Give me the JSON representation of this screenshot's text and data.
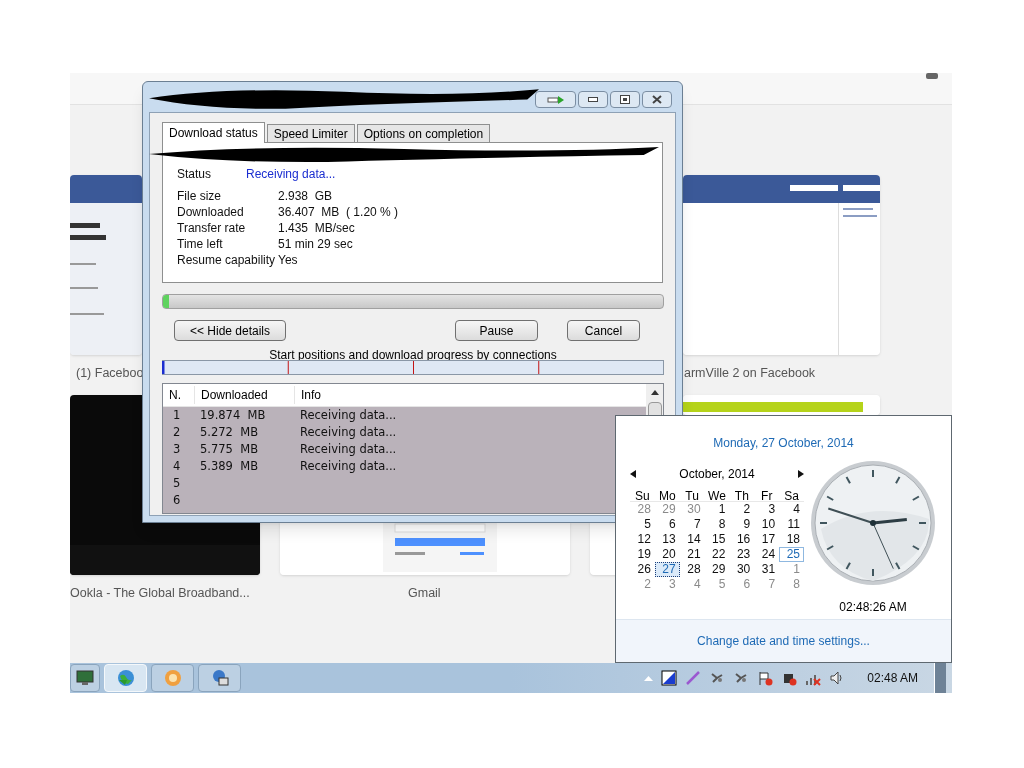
{
  "browser": {
    "tiles": [
      {
        "kind": "facebook",
        "caption": "(1) Faceboo"
      },
      {
        "kind": "farmville",
        "caption": "armVille 2 on Facebook"
      },
      {
        "kind": "ookla",
        "caption": "Ookla - The Global Broadband..."
      },
      {
        "kind": "gmail",
        "caption": "Gmail"
      },
      {
        "kind": "green"
      },
      {
        "kind": "blank"
      }
    ]
  },
  "download_window": {
    "tabs": [
      {
        "label": "Download status",
        "selected": true
      },
      {
        "label": "Speed Limiter",
        "selected": false
      },
      {
        "label": "Options on completion",
        "selected": false
      }
    ],
    "status": {
      "label": "Status",
      "value": "Receiving data..."
    },
    "details": [
      {
        "label": "File size",
        "value": "2.938  GB"
      },
      {
        "label": "Downloaded",
        "value": "36.407  MB  ( 1.20 % )"
      },
      {
        "label": "Transfer rate",
        "value": "1.435  MB/sec"
      },
      {
        "label": "Time left",
        "value": "51 min 29 sec"
      },
      {
        "label": "Resume capability",
        "value": "Yes"
      }
    ],
    "progress": {
      "level": 0.012
    },
    "buttons": {
      "hide_details": "<< Hide details",
      "pause": "Pause",
      "cancel": "Cancel"
    },
    "connections_caption": "Start positions and download progress by connections",
    "table": {
      "columns": [
        "N.",
        "Downloaded",
        "Info"
      ],
      "rows": [
        {
          "n": "1",
          "downloaded": "19.874  MB",
          "info": "Receiving data..."
        },
        {
          "n": "2",
          "downloaded": "5.272  MB",
          "info": "Receiving data..."
        },
        {
          "n": "3",
          "downloaded": "5.775  MB",
          "info": "Receiving data..."
        },
        {
          "n": "4",
          "downloaded": "5.389  MB",
          "info": "Receiving data..."
        },
        {
          "n": "5"
        },
        {
          "n": "6"
        }
      ]
    }
  },
  "calendar": {
    "heading": "Monday, 27 October, 2014",
    "month": "October, 2014",
    "weekdays": [
      "Su",
      "Mo",
      "Tu",
      "We",
      "Th",
      "Fr",
      "Sa"
    ],
    "weeks": [
      [
        {
          "d": "28",
          "muted": true,
          "selected": false,
          "hovered": false
        },
        {
          "d": "29",
          "muted": true,
          "selected": false,
          "hovered": false
        },
        {
          "d": "30",
          "muted": true,
          "selected": false,
          "hovered": false
        },
        {
          "d": "1",
          "muted": false,
          "selected": false,
          "hovered": false
        },
        {
          "d": "2",
          "muted": false,
          "selected": false,
          "hovered": false
        },
        {
          "d": "3",
          "muted": false,
          "selected": false,
          "hovered": false
        },
        {
          "d": "4",
          "muted": false,
          "selected": false,
          "hovered": false
        }
      ],
      [
        {
          "d": "5",
          "muted": false,
          "selected": false,
          "hovered": false
        },
        {
          "d": "6",
          "muted": false,
          "selected": false,
          "hovered": false
        },
        {
          "d": "7",
          "muted": false,
          "selected": false,
          "hovered": false
        },
        {
          "d": "8",
          "muted": false,
          "selected": false,
          "hovered": false
        },
        {
          "d": "9",
          "muted": false,
          "selected": false,
          "hovered": false
        },
        {
          "d": "10",
          "muted": false,
          "selected": false,
          "hovered": false
        },
        {
          "d": "11",
          "muted": false,
          "selected": false,
          "hovered": false
        }
      ],
      [
        {
          "d": "12",
          "muted": false,
          "selected": false,
          "hovered": false
        },
        {
          "d": "13",
          "muted": false,
          "selected": false,
          "hovered": false
        },
        {
          "d": "14",
          "muted": false,
          "selected": false,
          "hovered": false
        },
        {
          "d": "15",
          "muted": false,
          "selected": false,
          "hovered": false
        },
        {
          "d": "16",
          "muted": false,
          "selected": false,
          "hovered": false
        },
        {
          "d": "17",
          "muted": false,
          "selected": false,
          "hovered": false
        },
        {
          "d": "18",
          "muted": false,
          "selected": false,
          "hovered": false
        }
      ],
      [
        {
          "d": "19",
          "muted": false,
          "selected": false,
          "hovered": false
        },
        {
          "d": "20",
          "muted": false,
          "selected": false,
          "hovered": false
        },
        {
          "d": "21",
          "muted": false,
          "selected": false,
          "hovered": false
        },
        {
          "d": "22",
          "muted": false,
          "selected": false,
          "hovered": false
        },
        {
          "d": "23",
          "muted": false,
          "selected": false,
          "hovered": false
        },
        {
          "d": "24",
          "muted": false,
          "selected": false,
          "hovered": false
        },
        {
          "d": "25",
          "muted": false,
          "selected": false,
          "hovered": true
        }
      ],
      [
        {
          "d": "26",
          "muted": false,
          "selected": false,
          "hovered": false
        },
        {
          "d": "27",
          "muted": false,
          "selected": true,
          "hovered": false
        },
        {
          "d": "28",
          "muted": false,
          "selected": false,
          "hovered": false
        },
        {
          "d": "29",
          "muted": false,
          "selected": false,
          "hovered": false
        },
        {
          "d": "30",
          "muted": false,
          "selected": false,
          "hovered": false
        },
        {
          "d": "31",
          "muted": false,
          "selected": false,
          "hovered": false
        },
        {
          "d": "1",
          "muted": true,
          "selected": false,
          "hovered": false
        }
      ],
      [
        {
          "d": "2",
          "muted": true,
          "selected": false,
          "hovered": false
        },
        {
          "d": "3",
          "muted": true,
          "selected": false,
          "hovered": false
        },
        {
          "d": "4",
          "muted": true,
          "selected": false,
          "hovered": false
        },
        {
          "d": "5",
          "muted": true,
          "selected": false,
          "hovered": false
        },
        {
          "d": "6",
          "muted": true,
          "selected": false,
          "hovered": false
        },
        {
          "d": "7",
          "muted": true,
          "selected": false,
          "hovered": false
        },
        {
          "d": "8",
          "muted": true,
          "selected": false,
          "hovered": false
        }
      ]
    ],
    "time": "02:48:26 AM",
    "link": "Change date and time settings..."
  },
  "taskbar": {
    "buttons": [
      {
        "kind": "monitor",
        "selected": false
      },
      {
        "kind": "globe",
        "selected": true
      },
      {
        "kind": "badge",
        "selected": false
      },
      {
        "kind": "network",
        "selected": false
      }
    ],
    "clock": "02:48 AM"
  }
}
